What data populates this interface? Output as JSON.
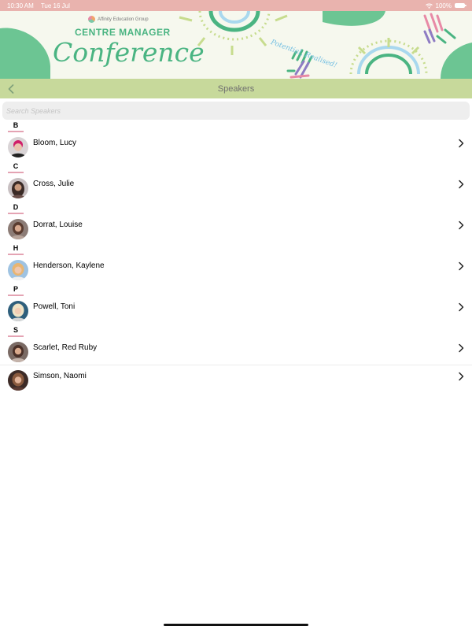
{
  "status_bar": {
    "time": "10:30 AM",
    "date": "Tue 16 Jul",
    "battery_percent": "100%",
    "battery_level": 1.0,
    "icons": [
      "wifi-icon",
      "battery-icon"
    ]
  },
  "banner": {
    "org_name": "Affinity Education Group",
    "kicker": "CENTRE MANAGER",
    "title": "Conference",
    "tagline": "Potential, Realised!",
    "colors": {
      "green": "#4ab482",
      "blue": "#74bfe2",
      "pink": "#e88aa6",
      "sun": "#c7dc8e",
      "bg": "#f6f8ee"
    }
  },
  "nav": {
    "title": "Speakers",
    "back_icon": "chevron-left-icon",
    "bar_color": "#c7d99b"
  },
  "search": {
    "placeholder": "Search Speakers",
    "value": ""
  },
  "sections": [
    {
      "letter": "B",
      "speakers": [
        {
          "name": "Bloom, Lucy"
        }
      ]
    },
    {
      "letter": "C",
      "speakers": [
        {
          "name": "Cross, Julie"
        }
      ]
    },
    {
      "letter": "D",
      "speakers": [
        {
          "name": "Dorrat, Louise"
        }
      ]
    },
    {
      "letter": "H",
      "speakers": [
        {
          "name": "Henderson, Kaylene"
        }
      ]
    },
    {
      "letter": "P",
      "speakers": [
        {
          "name": "Powell, Toni"
        }
      ]
    },
    {
      "letter": "S",
      "speakers": [
        {
          "name": "Scarlet, Red Ruby"
        },
        {
          "name": "Simson, Naomi"
        }
      ]
    }
  ],
  "accent": {
    "section_underline": "#e4a3b3",
    "status_bar": "#e9b3ae"
  }
}
